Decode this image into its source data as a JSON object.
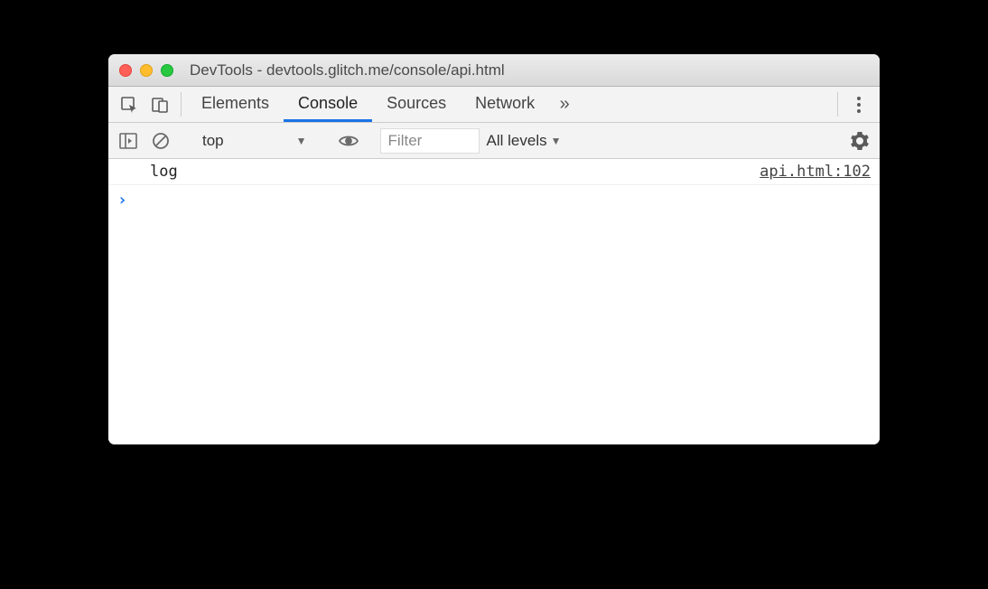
{
  "window": {
    "title": "DevTools - devtools.glitch.me/console/api.html"
  },
  "tabs": {
    "elements": "Elements",
    "console": "Console",
    "sources": "Sources",
    "network": "Network"
  },
  "toolbar": {
    "context": "top",
    "filter_placeholder": "Filter",
    "levels": "All levels"
  },
  "console": {
    "log_message": "log",
    "log_source": "api.html:102"
  }
}
